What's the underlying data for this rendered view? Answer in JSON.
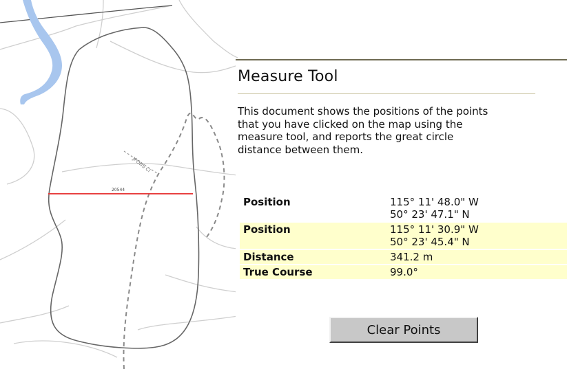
{
  "map": {
    "road_label_1": "JPONS Cl",
    "segment_label": "20544",
    "colors": {
      "background": "#ffffff",
      "roads": "#c8c8c8",
      "water": "#a8c6ee",
      "boundary": "#666666",
      "measure_line": "#e84040",
      "trail": "#8a8a8a"
    }
  },
  "panel": {
    "title": "Measure Tool",
    "description_lines": [
      "This document shows the positions of the points",
      "that you have clicked on the map using the",
      "measure tool, and reports the great circle",
      "distance between them."
    ],
    "rows": [
      {
        "label": "Position",
        "lines": [
          "115° 11' 48.0\" W",
          "50° 23' 47.1\" N"
        ]
      },
      {
        "label": "Position",
        "lines": [
          "115° 11' 30.9\" W",
          "50° 23' 45.4\" N"
        ]
      },
      {
        "label": "Distance",
        "lines": [
          "341.2 m"
        ]
      },
      {
        "label": "True Course",
        "lines": [
          "99.0°"
        ]
      }
    ],
    "clear_button_label": "Clear Points",
    "colors": {
      "alt_row": "#ffffcc",
      "rule": "#6e6a52",
      "title_rule": "#c9c4a0",
      "button": "#c8c8c8"
    }
  }
}
